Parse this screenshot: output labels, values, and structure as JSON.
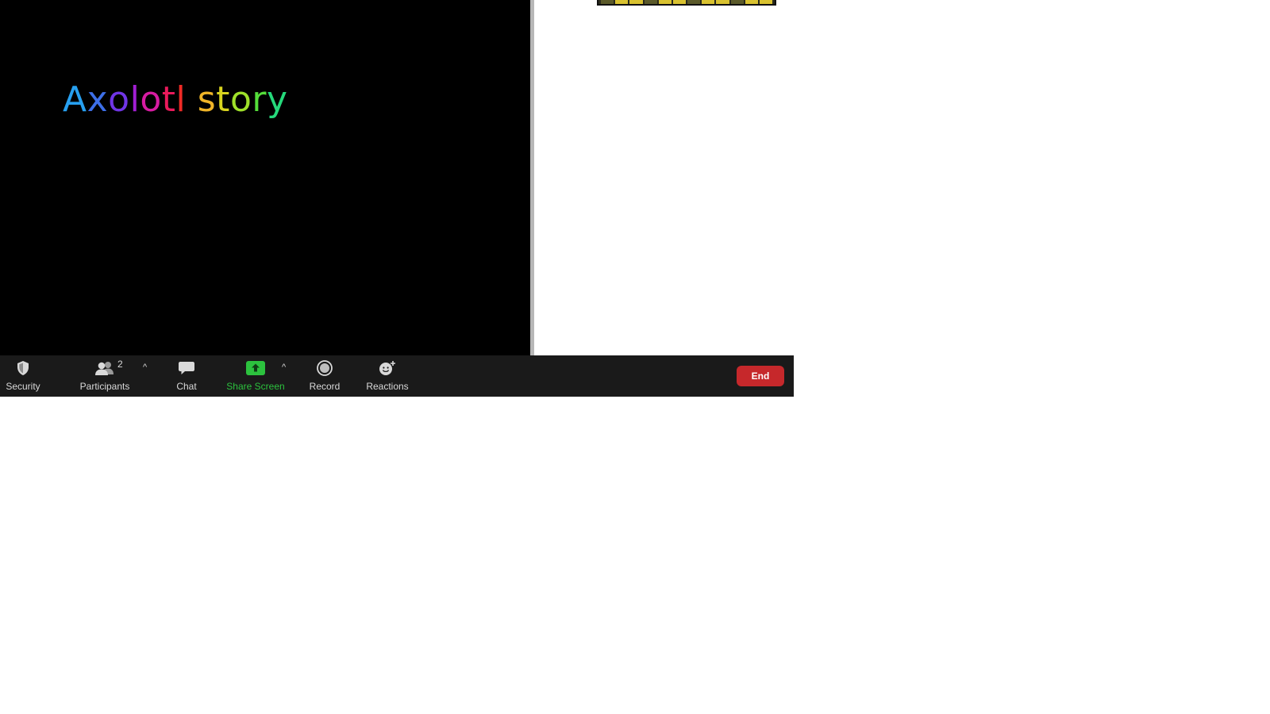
{
  "slide": {
    "title_word1": "Axolotl",
    "title_word2": "story",
    "letters": [
      {
        "ch": "A",
        "color": "#27a0f0"
      },
      {
        "ch": "x",
        "color": "#3d6fe8"
      },
      {
        "ch": "o",
        "color": "#7035e6"
      },
      {
        "ch": "l",
        "color": "#a21fd3"
      },
      {
        "ch": "o",
        "color": "#d71ca2"
      },
      {
        "ch": "t",
        "color": "#ea1a5b"
      },
      {
        "ch": "l",
        "color": "#ef2a25"
      },
      {
        "ch": " ",
        "color": "#ffffff"
      },
      {
        "ch": "s",
        "color": "#f0b528"
      },
      {
        "ch": "t",
        "color": "#d8d31f"
      },
      {
        "ch": "o",
        "color": "#9fe02a"
      },
      {
        "ch": "r",
        "color": "#55de3a"
      },
      {
        "ch": "y",
        "color": "#25d97b"
      }
    ]
  },
  "toolbar": {
    "security_label": "Security",
    "participants_label": "Participants",
    "participants_count": "2",
    "chat_label": "Chat",
    "share_screen_label": "Share Screen",
    "record_label": "Record",
    "reactions_label": "Reactions",
    "end_label": "End"
  },
  "colors": {
    "toolbar_bg": "#1a1a1a",
    "share_green": "#2cc23e",
    "end_red": "#c6282b"
  },
  "icons": [
    "shield-icon",
    "participants-icon",
    "chevron-up-icon",
    "chat-icon",
    "share-screen-icon",
    "record-icon",
    "reactions-icon"
  ]
}
